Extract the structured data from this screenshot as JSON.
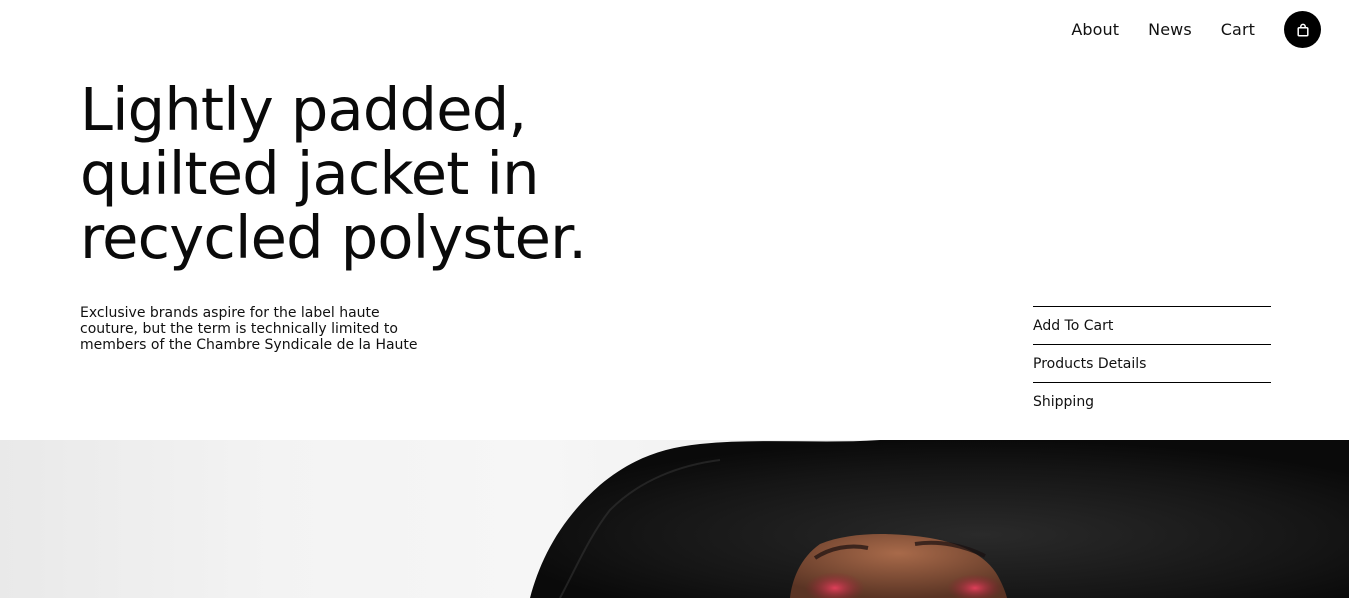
{
  "nav": {
    "links": [
      {
        "label": "About"
      },
      {
        "label": "News"
      },
      {
        "label": "Cart"
      }
    ],
    "cart_icon": "shopping-bag-icon"
  },
  "hero": {
    "title": "Lightly padded, quilted jacket in recycled polyster.",
    "description": "Exclusive brands aspire for the label haute couture, but the term is technically limited to members of the Chambre Syndicale de la Haute"
  },
  "side_menu": {
    "items": [
      {
        "label": "Add To Cart"
      },
      {
        "label": "Products Details"
      },
      {
        "label": "Shipping"
      }
    ]
  },
  "colors": {
    "text": "#000000",
    "background": "#ffffff",
    "button": "#000000"
  }
}
